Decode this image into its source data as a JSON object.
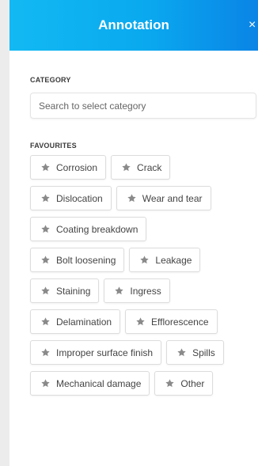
{
  "header": {
    "title": "Annotation",
    "close_glyph": "×"
  },
  "category": {
    "label": "CATEGORY",
    "search_placeholder": "Search to select category"
  },
  "favourites": {
    "label": "FAVOURITES",
    "rows": [
      [
        "Corrosion",
        "Crack"
      ],
      [
        "Dislocation",
        "Wear and tear"
      ],
      [
        "Coating breakdown"
      ],
      [
        "Bolt loosening",
        "Leakage"
      ],
      [
        "Staining",
        "Ingress"
      ],
      [
        "Delamination",
        "Efflorescence"
      ],
      [
        "Improper surface finish",
        "Spills"
      ],
      [
        "Mechanical damage",
        "Other"
      ]
    ],
    "icon": "star-icon"
  },
  "colors": {
    "header_gradient_start": "#12b9f2",
    "header_gradient_end": "#0a84e6",
    "star": "#8a8a8a",
    "chip_border": "#dcdcdc"
  }
}
